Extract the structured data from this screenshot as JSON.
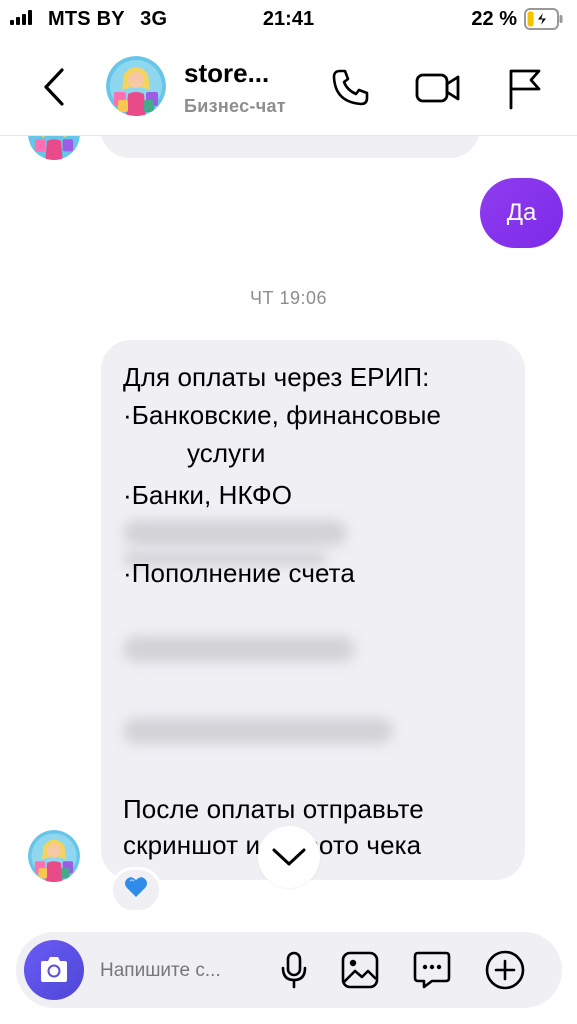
{
  "status_bar": {
    "carrier": "MTS BY",
    "network": "3G",
    "time": "21:41",
    "battery": "22 %",
    "battery_level": 22,
    "icons": [
      "signal-icon",
      "battery-charging-icon"
    ]
  },
  "header": {
    "title": "store...",
    "subtitle": "Бизнес-чат",
    "icons": [
      "back-chevron-icon",
      "avatar",
      "phone-icon",
      "video-camera-icon",
      "flag-icon"
    ]
  },
  "messages": {
    "outgoing_text": "Да",
    "timestamp": "ЧТ 19:06",
    "incoming_lines": [
      "Для оплаты через ЕРИП:",
      "·Банковские, финансовые",
      "услуги",
      "·Банки, НКФО",
      "·Пополнение счета",
      "После оплаты отправьте",
      "скриншот или фото чека"
    ],
    "reaction": "💙"
  },
  "composer": {
    "placeholder": "Напишите с...",
    "icons": [
      "camera-icon",
      "microphone-icon",
      "gallery-icon",
      "sticker-icon",
      "plus-icon"
    ]
  },
  "colors": {
    "accent_purple": "#8a2be2",
    "camera_button": "#5b51de",
    "bubble_gray": "#efeff4",
    "secondary_text": "#8e8e8e"
  }
}
